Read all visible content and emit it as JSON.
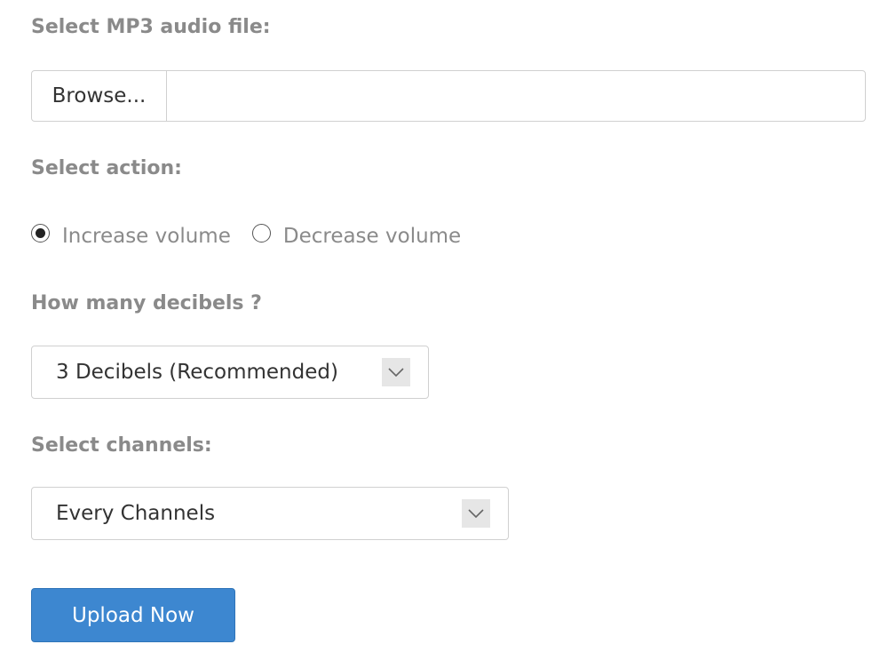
{
  "file_section": {
    "label": "Select MP3 audio file:",
    "browse_label": "Browse...",
    "file_name": ""
  },
  "action_section": {
    "label": "Select action:",
    "options": [
      {
        "label": "Increase volume",
        "selected": true
      },
      {
        "label": "Decrease volume",
        "selected": false
      }
    ]
  },
  "decibels_section": {
    "label": "How many decibels ?",
    "selected_value": "3 Decibels (Recommended)",
    "arrow_icon": "chevron-down-icon"
  },
  "channels_section": {
    "label": "Select channels:",
    "selected_value": "Every Channels",
    "arrow_icon": "chevron-down-icon"
  },
  "submit": {
    "label": "Upload Now",
    "color": "#3d87d0"
  }
}
